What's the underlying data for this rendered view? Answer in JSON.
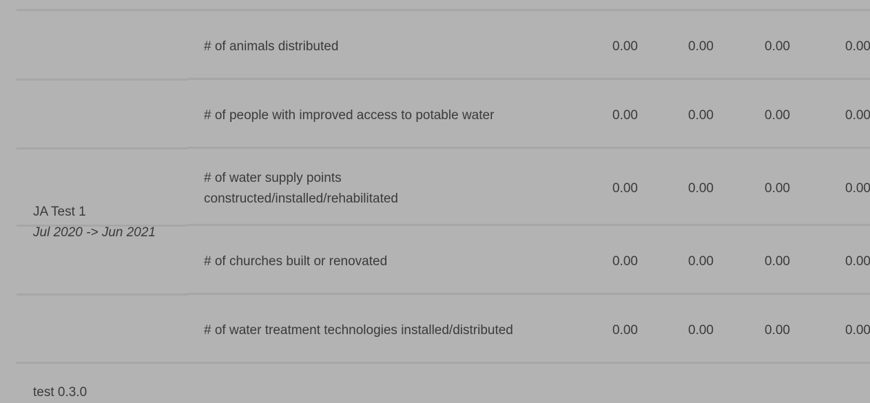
{
  "projects": [
    {
      "name": "JA Test 1",
      "period": "Jul 2020 -> Jun 2021",
      "rows": [
        {
          "indicator": "# of animals distributed",
          "values": [
            "0.00",
            "0.00",
            "0.00",
            "0.00"
          ]
        },
        {
          "indicator": "# of people with improved access to potable water",
          "values": [
            "0.00",
            "0.00",
            "0.00",
            "0.00"
          ]
        },
        {
          "indicator_line1": "# of water supply points",
          "indicator_line2": "constructed/installed/rehabilitated",
          "values": [
            "0.00",
            "0.00",
            "0.00",
            "0.00"
          ]
        },
        {
          "indicator": "# of churches built or renovated",
          "values": [
            "0.00",
            "0.00",
            "0.00",
            "0.00"
          ]
        },
        {
          "indicator": "# of water treatment technologies installed/distributed",
          "values": [
            "0.00",
            "0.00",
            "0.00",
            "0.00"
          ]
        }
      ]
    },
    {
      "name": "test 0.3.0"
    }
  ]
}
